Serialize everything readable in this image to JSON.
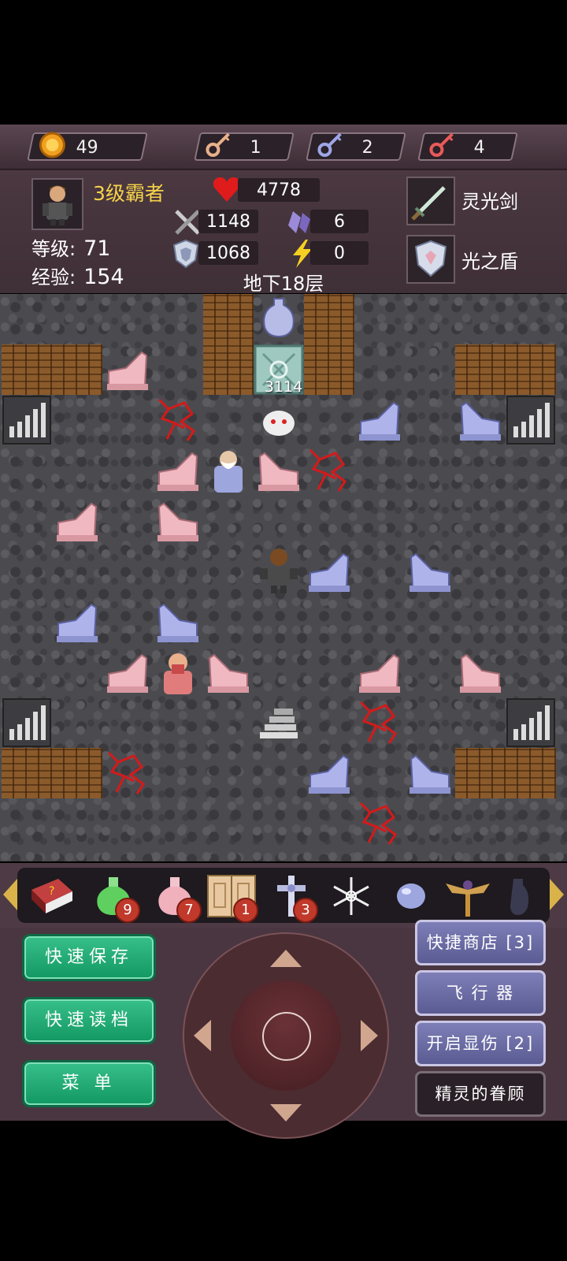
{
  "resources": {
    "gold": "49",
    "yellow_key": "1",
    "blue_key": "2",
    "red_key": "4"
  },
  "hero": {
    "title": "3级霸者",
    "level_label": "等级:",
    "level": "71",
    "exp_label": "经验:",
    "exp": "154",
    "hp": "4778",
    "attack": "1148",
    "defense": "1068",
    "magic_defense": "6",
    "energy": "0",
    "weapon": "灵光剑",
    "shield": "光之盾"
  },
  "floor": "地下18层",
  "map": {
    "monster_hp": "3114"
  },
  "items": {
    "green_potion_count": "9",
    "pink_potion_count": "7",
    "door_scroll_count": "1",
    "cross_count": "3"
  },
  "buttons": {
    "quick_save": "快速保存",
    "quick_load": "快速读档",
    "menu": "菜 单",
    "quick_shop": "快捷商店 [3]",
    "flyer": "飞 行 器",
    "show_damage": "开启显伤 [2]",
    "fairy_blessing": "精灵的眷顾"
  },
  "colors": {
    "title_gold": "#f6d34a",
    "green_button": "#129862",
    "purple_button": "#5a5b92"
  }
}
